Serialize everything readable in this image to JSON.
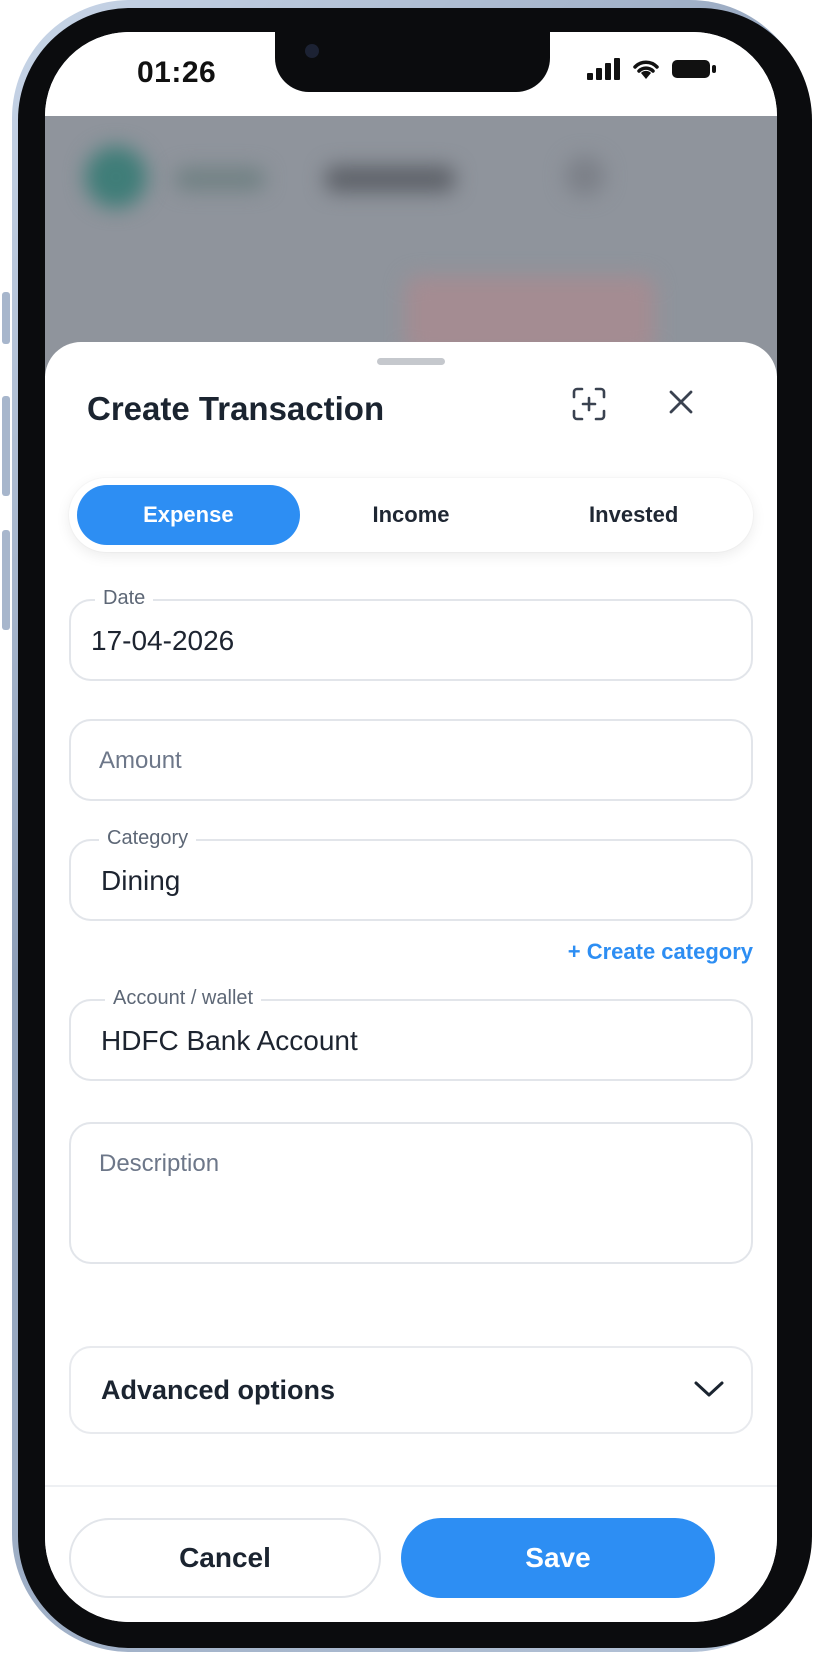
{
  "status_bar": {
    "time": "01:26"
  },
  "sheet": {
    "title": "Create Transaction",
    "scan_icon": "scan-add-icon",
    "close_icon": "close-icon"
  },
  "type_tabs": {
    "options": [
      "Expense",
      "Income",
      "Invested"
    ],
    "selected": "Expense"
  },
  "form": {
    "date": {
      "label": "Date",
      "value": "17-04-2026"
    },
    "amount": {
      "placeholder": "Amount",
      "value": ""
    },
    "category": {
      "label": "Category",
      "value": "Dining"
    },
    "create_category_link": "+ Create category",
    "account": {
      "label": "Account / wallet",
      "value": "HDFC Bank Account"
    },
    "description": {
      "placeholder": "Description",
      "value": ""
    },
    "advanced_options": "Advanced options"
  },
  "actions": {
    "cancel": "Cancel",
    "save": "Save"
  },
  "colors": {
    "accent": "#2d8ef3",
    "text": "#1b2430",
    "border": "#e2e5ea"
  }
}
